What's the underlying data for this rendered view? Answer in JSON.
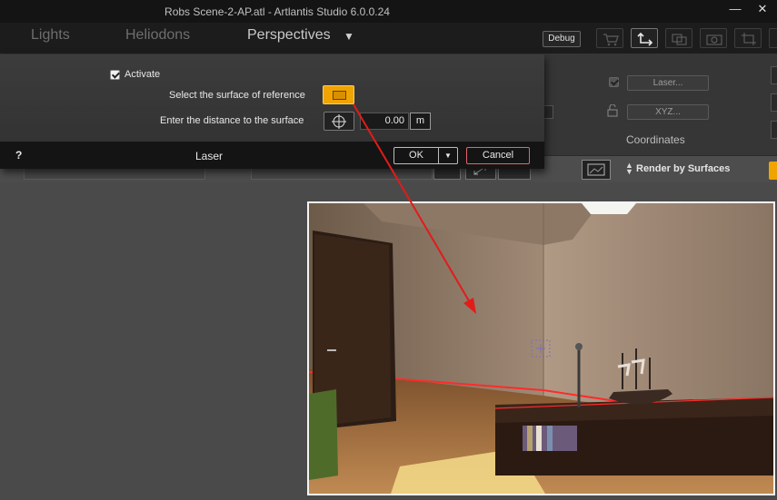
{
  "window": {
    "title": "Robs Scene-2-AP.atl - Artlantis Studio 6.0.0.24",
    "minimize_glyph": "—",
    "close_glyph": "✕"
  },
  "nav": {
    "tabs": [
      {
        "label": "Lights"
      },
      {
        "label": "Heliodons"
      },
      {
        "label": "Perspectives"
      }
    ],
    "debug_label": "Debug"
  },
  "panel": {
    "laser_button": "Laser...",
    "xyz_button": "XYZ...",
    "coordinates_label": "Coordinates"
  },
  "toolbar2": {
    "render_label": "Render by Surfaces"
  },
  "dialog": {
    "activate_label": "Activate",
    "activate_checked": true,
    "select_surface_label": "Select the surface of reference",
    "distance_label": "Enter the distance to the surface",
    "distance_value": "0.00",
    "unit": "m",
    "help_label": "?",
    "title": "Laser",
    "ok_label": "OK",
    "cancel_label": "Cancel"
  },
  "colors": {
    "accent": "#f0a400",
    "laser": "#ff2020",
    "arrow": "#e21b1b"
  }
}
